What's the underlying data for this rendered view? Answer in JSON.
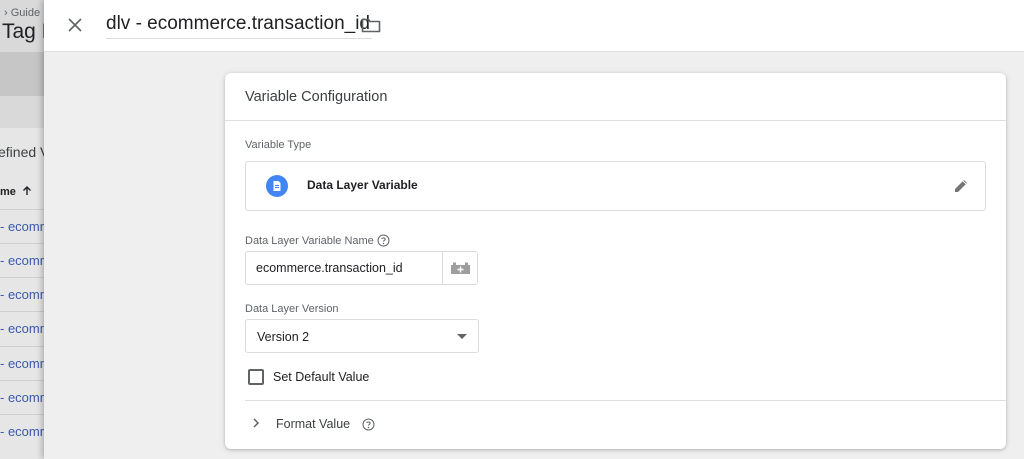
{
  "background": {
    "breadcrumb": "› Guide",
    "title": "Tag M",
    "section": "efined V",
    "column_header": "me",
    "rows": [
      "- ecomm",
      "- ecomm",
      "- ecomm",
      "- ecomm",
      "- ecomm",
      "- ecomm",
      "- ecomm"
    ]
  },
  "header": {
    "variable_name": "dlv - ecommerce.transaction_id"
  },
  "card": {
    "title": "Variable Configuration",
    "variable_type_label": "Variable Type",
    "variable_type_name": "Data Layer Variable",
    "dlv_name_label": "Data Layer Variable Name",
    "dlv_name_value": "ecommerce.transaction_id",
    "version_label": "Data Layer Version",
    "version_value": "Version 2",
    "default_value_label": "Set Default Value",
    "format_value_label": "Format Value"
  },
  "colors": {
    "accent": "#4285f4",
    "link": "#3b5aa8"
  },
  "icons": [
    "close-icon",
    "folder-icon",
    "document-icon",
    "pencil-icon",
    "help-icon",
    "variable-picker-icon",
    "chevron-right-icon",
    "sort-arrow-up-icon"
  ]
}
